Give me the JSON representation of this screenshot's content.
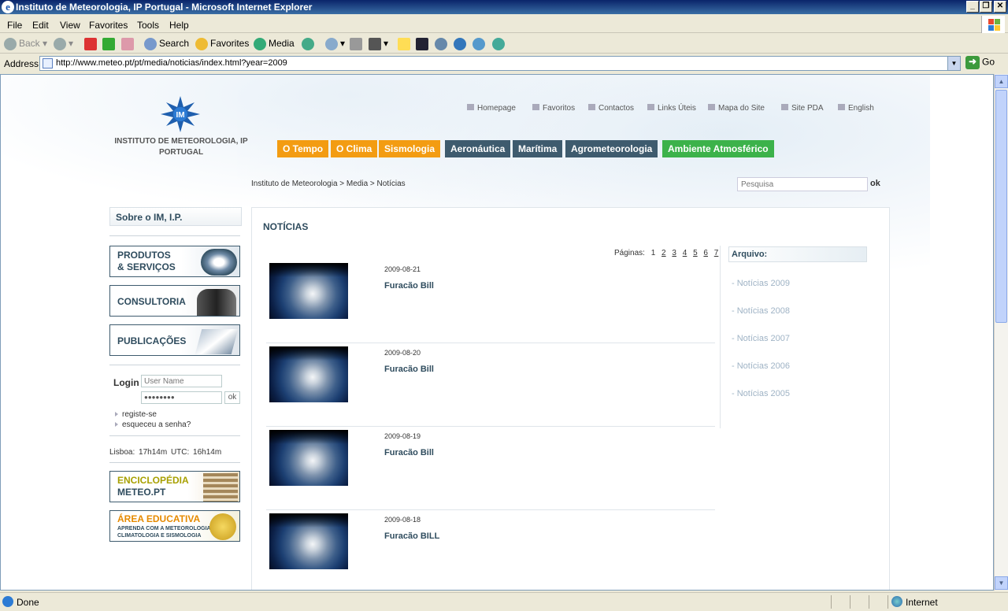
{
  "window": {
    "title": "Instituto de Meteorologia, IP Portugal - Microsoft Internet Explorer",
    "min": "_",
    "max": "❐",
    "close": "✕"
  },
  "menu": [
    "File",
    "Edit",
    "View",
    "Favorites",
    "Tools",
    "Help"
  ],
  "toolbar": {
    "back": "Back",
    "search": "Search",
    "favorites": "Favorites",
    "media": "Media"
  },
  "address": {
    "label": "Address",
    "url": "http://www.meteo.pt/pt/media/noticias/index.html?year=2009",
    "go": "Go"
  },
  "site": {
    "org": "INSTITUTO DE METEOROLOGIA, IP PORTUGAL",
    "logo": "IM",
    "toplinks": [
      "Homepage",
      "Favoritos",
      "Contactos",
      "Links Úteis",
      "Mapa do Site",
      "Site PDA",
      "English"
    ],
    "nav": [
      "O Tempo",
      "O Clima",
      "Sismologia",
      "Aeronáutica",
      "Marítima",
      "Agrometeorologia",
      "Ambiente Atmosférico"
    ],
    "breadcrumb": "Instituto de Meteorologia > Media > Notícias",
    "search_placeholder": "Pesquisa",
    "search_ok": "ok",
    "sidebar": {
      "about": "Sobre o IM, I.P.",
      "boxes": [
        "PRODUTOS",
        "& SERVIÇOS",
        "CONSULTORIA",
        "PUBLICAÇÕES"
      ],
      "login": "Login",
      "user_placeholder": "User Name",
      "password": "●●●●●●●●",
      "ok": "ok",
      "register": "registe-se",
      "forgot": "esqueceu a senha?",
      "clock": "Lisboa:  17h14m    UTC:  16h14m",
      "enciclopedia": [
        "ENCICLOPÉDIA",
        "METEO.PT"
      ],
      "educativa": [
        "ÁREA EDUCATIVA",
        "APRENDA COM A METEOROLOGIA,",
        "CLIMATOLOGIA E SISMOLOGIA"
      ]
    },
    "news": {
      "title": "NOTÍCIAS",
      "pages_label": "Páginas:",
      "pages": [
        "1",
        "2",
        "3",
        "4",
        "5",
        "6",
        "7"
      ],
      "items": [
        {
          "date": "2009-08-21",
          "title": "Furacão Bill"
        },
        {
          "date": "2009-08-20",
          "title": "Furacão Bill"
        },
        {
          "date": "2009-08-19",
          "title": "Furacão Bill"
        },
        {
          "date": "2009-08-18",
          "title": "Furacão BILL"
        }
      ],
      "archive_title": "Arquivo:",
      "archive": [
        "Notícias 2009",
        "Notícias 2008",
        "Notícias 2007",
        "Notícias 2006",
        "Notícias 2005"
      ]
    }
  },
  "status": {
    "left": "Done",
    "zone": "Internet"
  },
  "colors": {
    "orange": "#f39c12",
    "slate": "#3e5b6e",
    "green": "#3cb24a",
    "title_blue": "#0a246a"
  }
}
